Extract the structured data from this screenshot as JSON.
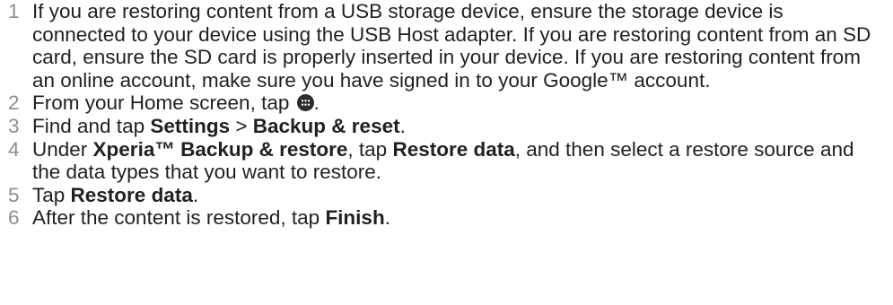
{
  "steps": [
    {
      "number": "1",
      "text": "If you are restoring content from a USB storage device, ensure the storage device is connected to your device using the USB Host adapter. If you are restoring content from an SD card, ensure the SD card is properly inserted in your device. If you are restoring content from an online account, make sure you have signed in to your Google™ account."
    },
    {
      "number": "2",
      "prefix": "From your Home screen, tap ",
      "icon": "apps-grid-icon",
      "suffix": "."
    },
    {
      "number": "3",
      "prefix": "Find and tap ",
      "bold1": "Settings",
      "mid": " > ",
      "bold2": "Backup & reset",
      "suffix": "."
    },
    {
      "number": "4",
      "prefix": "Under ",
      "bold1": "Xperia™ Backup & restore",
      "mid": ", tap ",
      "bold2": "Restore data",
      "suffix": ", and then select a restore source and the data types that you want to restore."
    },
    {
      "number": "5",
      "prefix": "Tap ",
      "bold1": "Restore data",
      "suffix": "."
    },
    {
      "number": "6",
      "prefix": "After the content is restored, tap ",
      "bold1": "Finish",
      "suffix": "."
    }
  ]
}
